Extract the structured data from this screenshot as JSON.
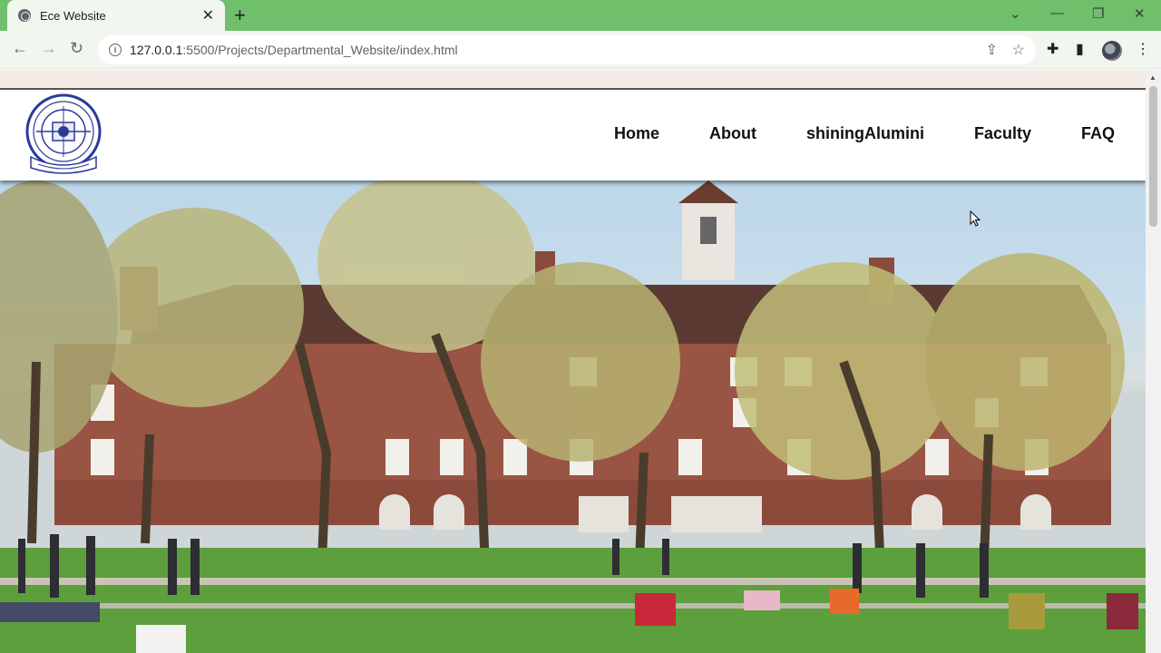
{
  "browser": {
    "tab_title": "Ece Website",
    "url_host": "127.0.0.1",
    "url_rest": ":5500/Projects/Departmental_Website/index.html"
  },
  "site": {
    "logo_icon": "college-emblem-icon",
    "nav": [
      "Home",
      "About",
      "shiningAlumini",
      "Faculty",
      "FAQ"
    ]
  },
  "hero": {
    "image": "campus-building-photo"
  }
}
